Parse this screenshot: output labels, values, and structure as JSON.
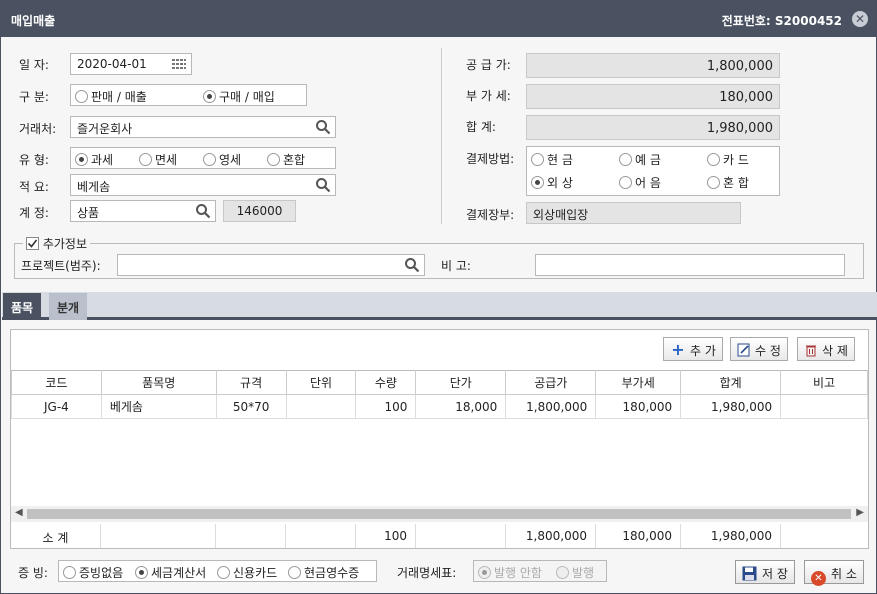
{
  "window": {
    "title": "매입매출",
    "slip_label": "전표번호: S2000452"
  },
  "form": {
    "date_label": "일  자:",
    "date_value": "2020-04-01",
    "type_label": "구  분:",
    "type_options": [
      "판매 / 매출",
      "구매 / 매입"
    ],
    "client_label": "거래처:",
    "client_value": "즐거운회사",
    "kind_label": "유  형:",
    "kind_options": [
      "과세",
      "면세",
      "영세",
      "혼합"
    ],
    "memo_label": "적  요:",
    "memo_value": "베게솜",
    "account_label": "계  정:",
    "account_value": "상품",
    "account_code": "146000",
    "supply_label": "공 급 가:",
    "supply_value": "1,800,000",
    "vat_label": "부 가 세:",
    "vat_value": "180,000",
    "total_label": "합    계:",
    "total_value": "1,980,000",
    "pay_label": "결제방법:",
    "pay_options": [
      "현 금",
      "예 금",
      "카 드",
      "외 상",
      "어 음",
      "혼 합"
    ],
    "ledger_label": "결제장부:",
    "ledger_value": "외상매입장",
    "extra_label": "추가정보",
    "project_label": "프로젝트(범주):",
    "project_value": "",
    "note_label": "비  고:",
    "note_value": ""
  },
  "tabs": [
    "품목",
    "분개"
  ],
  "toolbar": {
    "add": "추 가",
    "edit": "수 정",
    "delete": "삭 제"
  },
  "grid": {
    "columns": [
      "코드",
      "품목명",
      "규격",
      "단위",
      "수량",
      "단가",
      "공급가",
      "부가세",
      "합계",
      "비고"
    ],
    "rows": [
      [
        "JG-4",
        "베게솜",
        "50*70",
        "",
        "100",
        "18,000",
        "1,800,000",
        "180,000",
        "1,980,000",
        ""
      ]
    ],
    "subtotal": {
      "label": "소 계",
      "qty": "100",
      "supply": "1,800,000",
      "vat": "180,000",
      "total": "1,980,000"
    }
  },
  "footer": {
    "evidence_label": "증 빙:",
    "evidence_options": [
      "증빙없음",
      "세금계산서",
      "신용카드",
      "현금영수증"
    ],
    "statement_label": "거래명세표:",
    "statement_options": [
      "발행 안함",
      "발행"
    ],
    "save": "저 장",
    "cancel": "취 소"
  },
  "colors": {
    "titlebar": "#4a5262",
    "accent_blue": "#2a63c6",
    "cancel_red": "#d94a2a"
  }
}
